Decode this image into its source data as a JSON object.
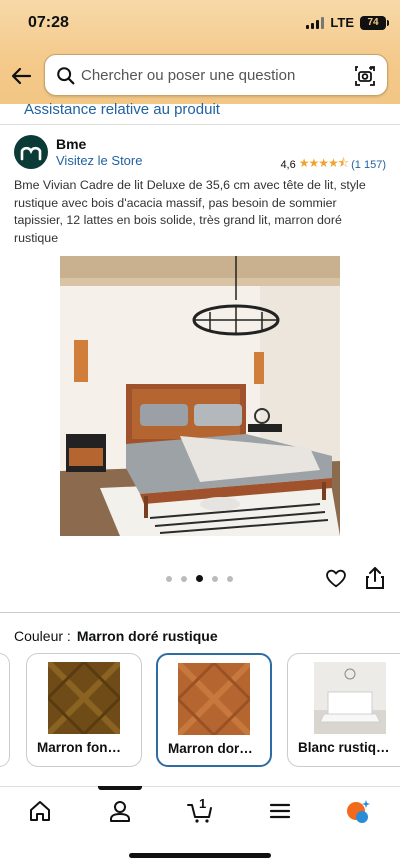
{
  "status_bar": {
    "time": "07:28",
    "network": "LTE",
    "battery": "74"
  },
  "search": {
    "placeholder": "Chercher ou poser une question"
  },
  "assist_link": "Assistance relative au produit",
  "brand": {
    "name": "Bme",
    "store_link": "Visitez le Store",
    "rating": "4,6",
    "stars": "★★★★⯪",
    "review_count": "(1 157)"
  },
  "product": {
    "title": "Bme Vivian Cadre de lit Deluxe de 35,6 cm avec tête de lit, style rustique avec bois d'acacia massif, pas besoin de sommier tapissier, 12 lattes en bois solide, très grand lit, marron doré rustique",
    "image_dots": 5,
    "active_dot": 3
  },
  "color_selector": {
    "label": "Couleur :",
    "selected": "Marron doré rustique",
    "options": [
      {
        "label": "Marron fon…"
      },
      {
        "label": "Marron dor…"
      },
      {
        "label": "Blanc rustiq…"
      }
    ]
  },
  "icons": {
    "back": "back-arrow-icon",
    "search": "search-icon",
    "camera": "camera-icon",
    "heart": "heart-icon",
    "share": "share-icon",
    "nav": [
      "home-icon",
      "account-icon",
      "cart-icon",
      "menu-icon",
      "rufus-icon"
    ]
  },
  "bottom_nav": {
    "cart_count": "1"
  },
  "colors": {
    "header": "#f4c98a",
    "link": "#2162a1",
    "star": "#f0a330",
    "selected_border": "#2e6ca4",
    "brand_logo": "#0b3b36"
  }
}
